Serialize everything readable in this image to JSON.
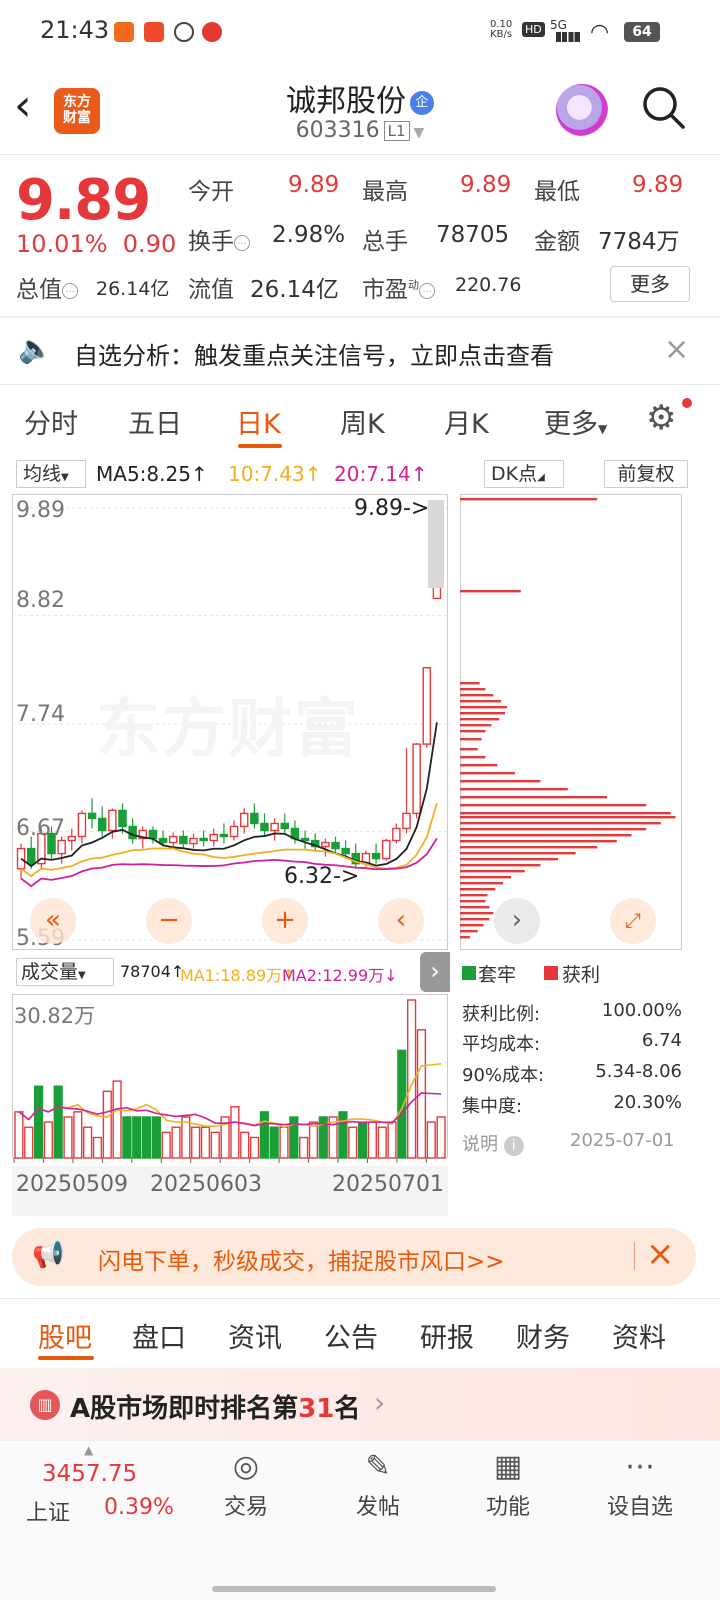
{
  "status_bar": {
    "time": "21:43",
    "net_speed": "0.10",
    "net_unit": "KB/s",
    "hd": "HD",
    "sig": "5G",
    "battery": "64"
  },
  "header": {
    "title": "诚邦股份",
    "qi_badge": "企",
    "code": "603316",
    "level": "L1",
    "logo_line1": "东方",
    "logo_line2": "财富"
  },
  "quote": {
    "price": "9.89",
    "change_pct": "10.01%",
    "change": "0.90",
    "open_label": "今开",
    "open": "9.89",
    "high_label": "最高",
    "high": "9.89",
    "low_label": "最低",
    "low": "9.89",
    "turnover_label": "换手",
    "turnover": "2.98%",
    "volume_label": "总手",
    "volume": "78705",
    "amount_label": "金额",
    "amount": "7784万",
    "total_mv_label": "总值",
    "total_mv": "26.14亿",
    "float_mv_label": "流值",
    "float_mv": "26.14亿",
    "pe_label": "市盈",
    "pe_sup": "动",
    "pe": "220.76",
    "more_label": "更多"
  },
  "notice": {
    "text": "自选分析：触发重点关注信号，立即点击查看"
  },
  "chart_tabs": [
    "分时",
    "五日",
    "日K",
    "周K",
    "月K",
    "更多"
  ],
  "ma_bar": {
    "selector": "均线",
    "ma5": "MA5:8.25↑",
    "ma10": "10:7.43↑",
    "ma20": "20:7.14↑",
    "dk": "DK点",
    "fq": "前复权"
  },
  "kline": {
    "y_ticks": [
      "9.89",
      "8.82",
      "7.74",
      "6.67",
      "5.59"
    ],
    "max_label": "9.89->",
    "min_label": "6.32->",
    "watermark": "东方财富"
  },
  "volume": {
    "selector": "成交量",
    "current": "78704↑",
    "ma1": "MA1:18.89万↑",
    "ma2": "MA2:12.99万↓",
    "max_label": "30.82万",
    "dates": [
      "20250509",
      "20250603",
      "20250701"
    ]
  },
  "chips": {
    "legend_trap": "套牢",
    "legend_profit": "获利",
    "stats": [
      [
        "获利比例:",
        "100.00%"
      ],
      [
        "平均成本:",
        "6.74"
      ],
      [
        "90%成本:",
        "5.34-8.06"
      ],
      [
        "集中度:",
        "20.30%"
      ]
    ],
    "explain": "说明",
    "date": "2025-07-01"
  },
  "banner": {
    "text": "闪电下单，秒级成交，捕捉股市风口>>"
  },
  "bottom_tabs": [
    "股吧",
    "盘口",
    "资讯",
    "公告",
    "研报",
    "财务",
    "资料"
  ],
  "rank": {
    "prefix": "A股市场即时排名第",
    "num": "31",
    "suffix": "名"
  },
  "bottom_nav": {
    "index_value": "3457.75",
    "index_name": "上证",
    "index_pct": "0.39%",
    "items": [
      "交易",
      "发帖",
      "功能",
      "设自选"
    ]
  },
  "colors": {
    "up": "#e5383b",
    "down": "#1a9e38",
    "accent": "#e8590c",
    "ma5": "#222222",
    "ma10": "#f2b01e",
    "ma20": "#d0209a"
  },
  "chart_data": [
    {
      "type": "candlestick",
      "title": "",
      "ylim": [
        5.59,
        9.89
      ],
      "y_ticks": [
        9.89,
        8.82,
        7.74,
        6.67,
        5.59
      ],
      "ohlc": [
        [
          6.3,
          6.55,
          6.2,
          6.5
        ],
        [
          6.5,
          6.62,
          6.3,
          6.35
        ],
        [
          6.35,
          6.7,
          6.3,
          6.65
        ],
        [
          6.65,
          6.72,
          6.4,
          6.45
        ],
        [
          6.45,
          6.62,
          6.35,
          6.58
        ],
        [
          6.58,
          6.7,
          6.48,
          6.62
        ],
        [
          6.62,
          6.88,
          6.55,
          6.85
        ],
        [
          6.85,
          7.0,
          6.7,
          6.8
        ],
        [
          6.8,
          6.92,
          6.62,
          6.68
        ],
        [
          6.68,
          6.9,
          6.6,
          6.88
        ],
        [
          6.88,
          6.95,
          6.65,
          6.72
        ],
        [
          6.72,
          6.8,
          6.55,
          6.6
        ],
        [
          6.6,
          6.72,
          6.5,
          6.68
        ],
        [
          6.68,
          6.72,
          6.55,
          6.6
        ],
        [
          6.6,
          6.68,
          6.52,
          6.56
        ],
        [
          6.56,
          6.66,
          6.5,
          6.62
        ],
        [
          6.62,
          6.68,
          6.5,
          6.55
        ],
        [
          6.55,
          6.65,
          6.5,
          6.6
        ],
        [
          6.6,
          6.68,
          6.52,
          6.58
        ],
        [
          6.58,
          6.7,
          6.52,
          6.64
        ],
        [
          6.64,
          6.75,
          6.55,
          6.62
        ],
        [
          6.62,
          6.78,
          6.58,
          6.72
        ],
        [
          6.72,
          6.9,
          6.65,
          6.85
        ],
        [
          6.85,
          6.95,
          6.7,
          6.75
        ],
        [
          6.75,
          6.85,
          6.62,
          6.68
        ],
        [
          6.68,
          6.8,
          6.58,
          6.75
        ],
        [
          6.75,
          6.85,
          6.65,
          6.7
        ],
        [
          6.7,
          6.78,
          6.55,
          6.6
        ],
        [
          6.6,
          6.68,
          6.5,
          6.58
        ],
        [
          6.58,
          6.65,
          6.48,
          6.52
        ],
        [
          6.52,
          6.6,
          6.42,
          6.56
        ],
        [
          6.56,
          6.62,
          6.45,
          6.5
        ],
        [
          6.5,
          6.58,
          6.4,
          6.45
        ],
        [
          6.45,
          6.55,
          6.3,
          6.35
        ],
        [
          6.35,
          6.48,
          6.32,
          6.45
        ],
        [
          6.45,
          6.55,
          6.35,
          6.4
        ],
        [
          6.4,
          6.6,
          6.38,
          6.58
        ],
        [
          6.58,
          6.75,
          6.55,
          6.7
        ],
        [
          6.7,
          7.5,
          6.65,
          6.85
        ],
        [
          6.85,
          7.55,
          6.8,
          7.54
        ],
        [
          7.54,
          8.3,
          7.5,
          8.3
        ],
        [
          8.99,
          9.89,
          8.99,
          9.89
        ]
      ],
      "ma_series": [
        {
          "name": "MA5",
          "value": "8.25"
        },
        {
          "name": "MA10",
          "value": "7.43"
        },
        {
          "name": "MA20",
          "value": "7.14"
        }
      ]
    },
    {
      "type": "bar",
      "title": "成交量",
      "ymax_label": "30.82万",
      "values": [
        9,
        6,
        14,
        7,
        14,
        8,
        9,
        6,
        4,
        13,
        15,
        8,
        8,
        8,
        8,
        5,
        6,
        8,
        6,
        6,
        5,
        8,
        10,
        5,
        4,
        9,
        6,
        6,
        8,
        4,
        7,
        8,
        8,
        9,
        6,
        7,
        7,
        6,
        7,
        21,
        30.82,
        25,
        7,
        8
      ],
      "up": [
        1,
        1,
        0,
        1,
        0,
        1,
        1,
        1,
        1,
        1,
        1,
        0,
        0,
        0,
        0,
        1,
        1,
        1,
        1,
        1,
        1,
        1,
        1,
        1,
        1,
        0,
        0,
        1,
        0,
        1,
        1,
        0,
        1,
        0,
        1,
        0,
        1,
        1,
        1,
        0,
        1,
        1,
        1,
        1
      ],
      "dates": [
        "20250509",
        "20250603",
        "20250701"
      ]
    },
    {
      "type": "bar",
      "title": "筹码分布",
      "orientation": "horizontal",
      "unit": "relative"
    }
  ]
}
